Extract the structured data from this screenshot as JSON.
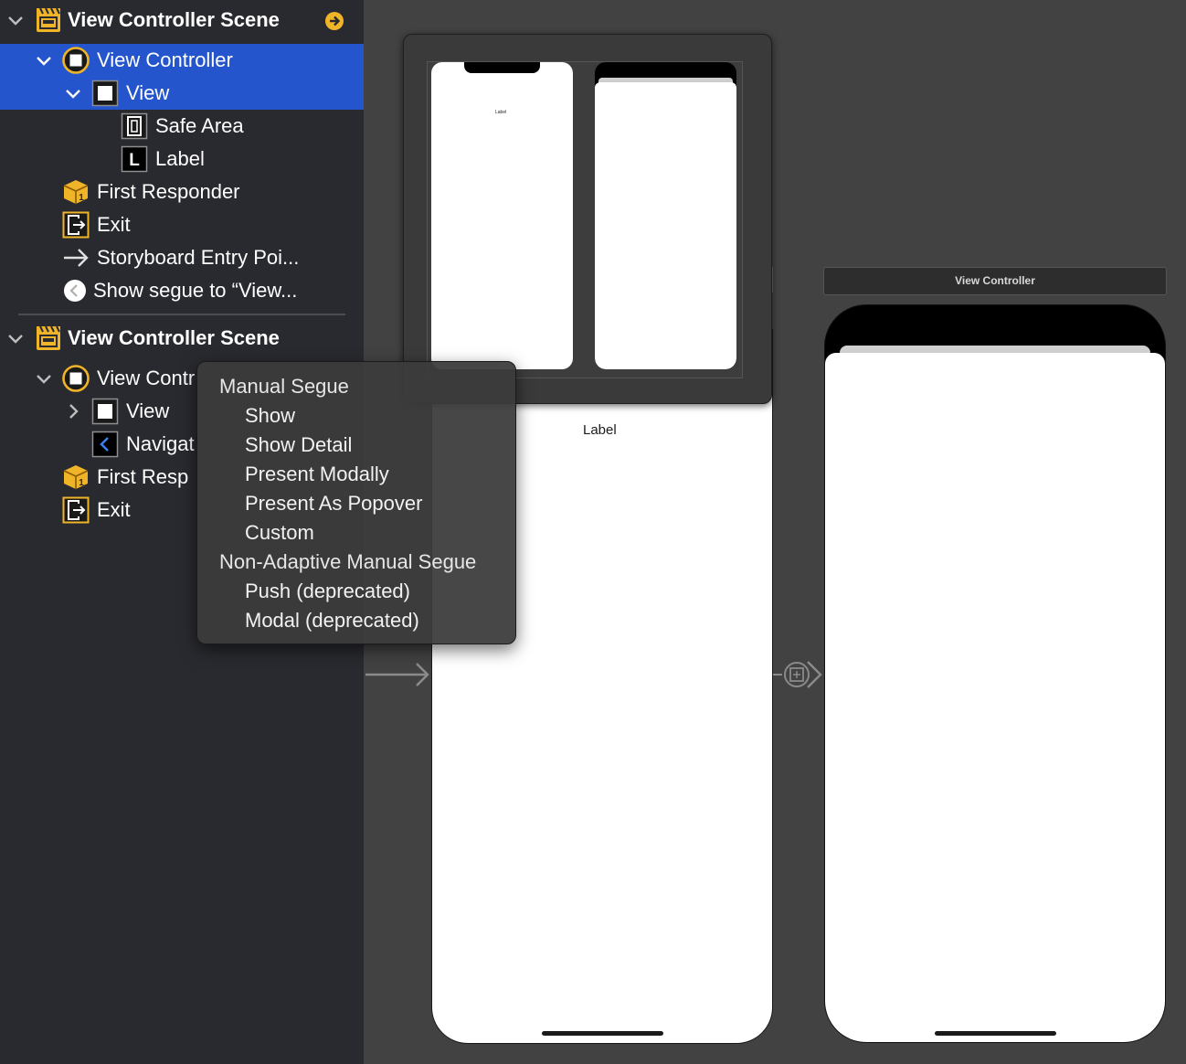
{
  "outline": {
    "items": [
      {
        "label": "View Controller Scene",
        "icon": "scene-icon",
        "chevron": "chevron-down-icon",
        "extra_icon": "arrow-right-circle-icon"
      },
      {
        "label": "View Controller",
        "icon": "view-controller-icon",
        "chevron": "chevron-down-icon",
        "selected": true
      },
      {
        "label": "View",
        "icon": "view-icon",
        "chevron": "chevron-down-icon",
        "selected": true
      },
      {
        "label": "Safe Area",
        "icon": "safe-area-icon"
      },
      {
        "label": "Label",
        "icon": "label-icon"
      },
      {
        "label": "First Responder",
        "icon": "first-responder-icon"
      },
      {
        "label": "Exit",
        "icon": "exit-icon"
      },
      {
        "label": "Storyboard Entry Poi...",
        "icon": "arrow-right-icon"
      },
      {
        "label": "Show segue to “View...",
        "icon": "segue-icon"
      },
      {
        "label": "View Controller Scene",
        "icon": "scene-icon",
        "chevron": "chevron-down-icon"
      },
      {
        "label": "View Contr",
        "icon": "view-controller-icon",
        "chevron": "chevron-down-icon"
      },
      {
        "label": "View",
        "icon": "view-icon",
        "chevron": "chevron-right-icon"
      },
      {
        "label": "Navigat",
        "icon": "back-chevron-icon"
      },
      {
        "label": "First Resp",
        "icon": "first-responder-icon"
      },
      {
        "label": "Exit",
        "icon": "exit-icon"
      }
    ]
  },
  "canvas": {
    "scene_title": "View Controller",
    "main_label": "Label",
    "mini_label": "Label"
  },
  "menu": {
    "items": [
      {
        "label": "Manual Segue",
        "kind": "header"
      },
      {
        "label": "Show",
        "kind": "option"
      },
      {
        "label": "Show Detail",
        "kind": "option"
      },
      {
        "label": "Present Modally",
        "kind": "option"
      },
      {
        "label": "Present As Popover",
        "kind": "option"
      },
      {
        "label": "Custom",
        "kind": "option"
      },
      {
        "label": "Non-Adaptive Manual Segue",
        "kind": "header"
      },
      {
        "label": "Push (deprecated)",
        "kind": "option"
      },
      {
        "label": "Modal (deprecated)",
        "kind": "option"
      }
    ]
  },
  "colors": {
    "selection": "#2455cc",
    "sidebar_bg": "#292a2f",
    "canvas_bg": "#424242",
    "scene_icon": "#f0b429"
  }
}
